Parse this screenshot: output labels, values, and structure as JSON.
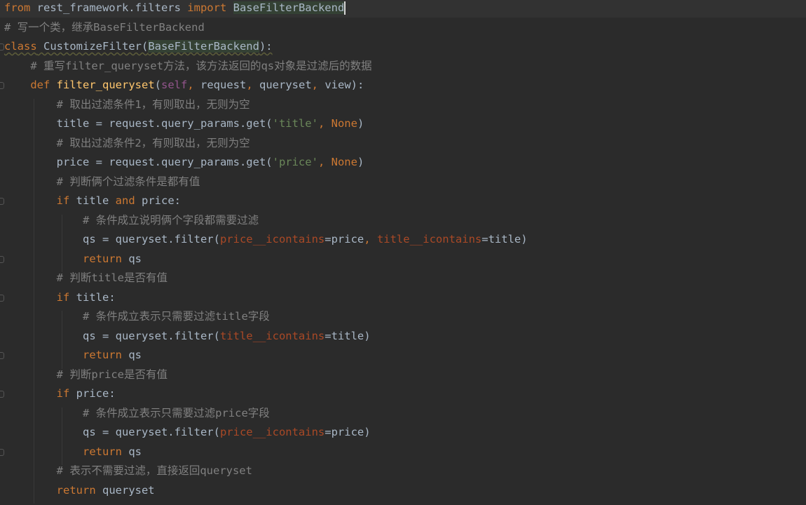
{
  "editor": {
    "colors": {
      "background": "#2b2b2b",
      "keyword": "#cc7832",
      "comment": "#808080",
      "function": "#ffc66d",
      "string": "#6a8759",
      "self": "#94558d",
      "kwarg": "#aa4926",
      "text": "#a9b7c6"
    },
    "lines": [
      {
        "tokens": [
          {
            "t": "from",
            "c": "kw"
          },
          {
            "t": " rest_framework.filters ",
            "c": ""
          },
          {
            "t": "import",
            "c": "kw"
          },
          {
            "t": " ",
            "c": ""
          },
          {
            "t": "BaseFilterBackend",
            "c": "cls-hl"
          }
        ]
      },
      {
        "tokens": [
          {
            "t": "# 写一个类，继承BaseFilterBackend",
            "c": "cm"
          }
        ]
      },
      {
        "tokens": [
          {
            "t": "class",
            "c": "kw wavy"
          },
          {
            "t": " CustomizeFilter(",
            "c": "wavy"
          },
          {
            "t": "BaseFilterBackend",
            "c": "cls-hl wavy"
          },
          {
            "t": "):",
            "c": "wavy"
          }
        ]
      },
      {
        "tokens": [
          {
            "t": "    # 重写filter_queryset方法，该方法返回的qs对象是过滤后的数据",
            "c": "cm"
          }
        ]
      },
      {
        "tokens": [
          {
            "t": "    ",
            "c": ""
          },
          {
            "t": "def",
            "c": "kw"
          },
          {
            "t": " ",
            "c": ""
          },
          {
            "t": "filter_queryset",
            "c": "fn"
          },
          {
            "t": "(",
            "c": ""
          },
          {
            "t": "self",
            "c": "self"
          },
          {
            "t": ", ",
            "c": "kw"
          },
          {
            "t": "request",
            "c": ""
          },
          {
            "t": ", ",
            "c": "kw"
          },
          {
            "t": "queryset",
            "c": ""
          },
          {
            "t": ", ",
            "c": "kw"
          },
          {
            "t": "view):",
            "c": ""
          }
        ]
      },
      {
        "tokens": [
          {
            "t": "        # 取出过滤条件1，有则取出，无则为空",
            "c": "cm"
          }
        ]
      },
      {
        "tokens": [
          {
            "t": "        title = request.query_params.get(",
            "c": ""
          },
          {
            "t": "'title'",
            "c": "str"
          },
          {
            "t": ", ",
            "c": "kw"
          },
          {
            "t": "None",
            "c": "kw"
          },
          {
            "t": ")",
            "c": ""
          }
        ]
      },
      {
        "tokens": [
          {
            "t": "        # 取出过滤条件2，有则取出，无则为空",
            "c": "cm"
          }
        ]
      },
      {
        "tokens": [
          {
            "t": "        price = request.query_params.get(",
            "c": ""
          },
          {
            "t": "'price'",
            "c": "str"
          },
          {
            "t": ", ",
            "c": "kw"
          },
          {
            "t": "None",
            "c": "kw"
          },
          {
            "t": ")",
            "c": ""
          }
        ]
      },
      {
        "tokens": [
          {
            "t": "        # 判断俩个过滤条件是都有值",
            "c": "cm"
          }
        ]
      },
      {
        "tokens": [
          {
            "t": "        ",
            "c": ""
          },
          {
            "t": "if",
            "c": "kw"
          },
          {
            "t": " title ",
            "c": ""
          },
          {
            "t": "and",
            "c": "kw"
          },
          {
            "t": " price:",
            "c": ""
          }
        ]
      },
      {
        "tokens": [
          {
            "t": "            # 条件成立说明俩个字段都需要过滤",
            "c": "cm"
          }
        ]
      },
      {
        "tokens": [
          {
            "t": "            qs = queryset.filter(",
            "c": ""
          },
          {
            "t": "price__icontains",
            "c": "param"
          },
          {
            "t": "=price",
            "c": ""
          },
          {
            "t": ", ",
            "c": "kw"
          },
          {
            "t": "title__icontains",
            "c": "param"
          },
          {
            "t": "=title)",
            "c": ""
          }
        ]
      },
      {
        "tokens": [
          {
            "t": "            ",
            "c": ""
          },
          {
            "t": "return",
            "c": "kw"
          },
          {
            "t": " qs",
            "c": ""
          }
        ]
      },
      {
        "tokens": [
          {
            "t": "        # 判断title是否有值",
            "c": "cm"
          }
        ]
      },
      {
        "tokens": [
          {
            "t": "        ",
            "c": ""
          },
          {
            "t": "if",
            "c": "kw"
          },
          {
            "t": " title:",
            "c": ""
          }
        ]
      },
      {
        "tokens": [
          {
            "t": "            # 条件成立表示只需要过滤title字段",
            "c": "cm"
          }
        ]
      },
      {
        "tokens": [
          {
            "t": "            qs = queryset.filter(",
            "c": ""
          },
          {
            "t": "title__icontains",
            "c": "param"
          },
          {
            "t": "=title)",
            "c": ""
          }
        ]
      },
      {
        "tokens": [
          {
            "t": "            ",
            "c": ""
          },
          {
            "t": "return",
            "c": "kw"
          },
          {
            "t": " qs",
            "c": ""
          }
        ]
      },
      {
        "tokens": [
          {
            "t": "        # 判断price是否有值",
            "c": "cm"
          }
        ]
      },
      {
        "tokens": [
          {
            "t": "        ",
            "c": ""
          },
          {
            "t": "if",
            "c": "kw"
          },
          {
            "t": " price:",
            "c": ""
          }
        ]
      },
      {
        "tokens": [
          {
            "t": "            # 条件成立表示只需要过滤price字段",
            "c": "cm"
          }
        ]
      },
      {
        "tokens": [
          {
            "t": "            qs = queryset.filter(",
            "c": ""
          },
          {
            "t": "price__icontains",
            "c": "param"
          },
          {
            "t": "=price)",
            "c": ""
          }
        ]
      },
      {
        "tokens": [
          {
            "t": "            ",
            "c": ""
          },
          {
            "t": "return",
            "c": "kw"
          },
          {
            "t": " qs",
            "c": ""
          }
        ]
      },
      {
        "tokens": [
          {
            "t": "        # 表示不需要过滤，直接返回queryset",
            "c": "cm"
          }
        ]
      },
      {
        "tokens": [
          {
            "t": "        ",
            "c": ""
          },
          {
            "t": "return",
            "c": "kw"
          },
          {
            "t": " queryset",
            "c": ""
          }
        ]
      }
    ]
  }
}
